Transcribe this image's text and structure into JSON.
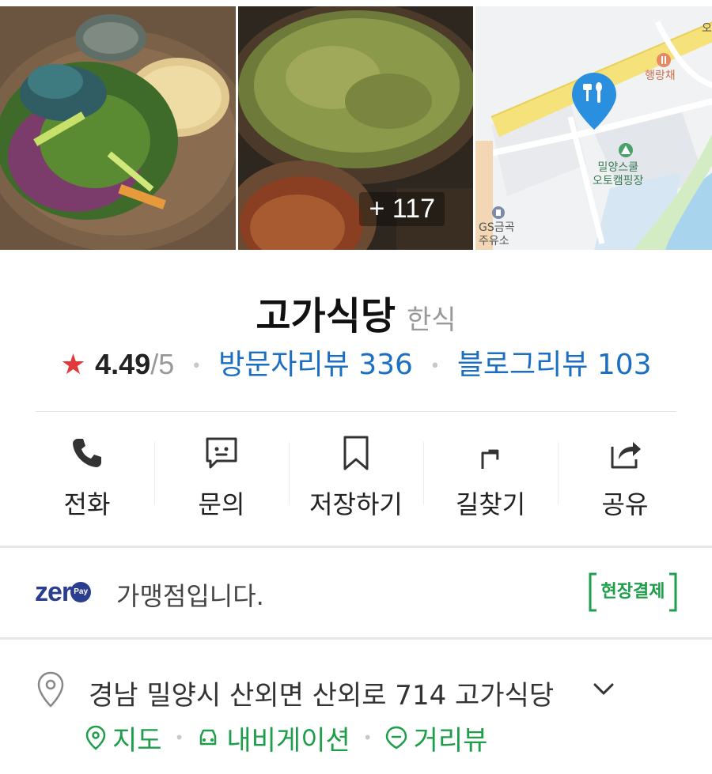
{
  "photos": {
    "more_count": "+ 117",
    "map": {
      "restaurant_label": "행랑채",
      "camping_label": "밀양스쿨\n오토캠핑장",
      "gas_label": "GS금곡\n주유소",
      "edge_label": "오"
    }
  },
  "place": {
    "name": "고가식당",
    "category": "한식"
  },
  "rating": {
    "score": "4.49",
    "max": "/5",
    "visitor_reviews": "방문자리뷰 336",
    "blog_reviews": "블로그리뷰 103"
  },
  "actions": [
    {
      "label": "전화",
      "icon": "phone-icon"
    },
    {
      "label": "문의",
      "icon": "chat-icon"
    },
    {
      "label": "저장하기",
      "icon": "bookmark-icon"
    },
    {
      "label": "길찾기",
      "icon": "directions-icon"
    },
    {
      "label": "공유",
      "icon": "share-icon"
    }
  ],
  "zeropay": {
    "logo_text": "zer",
    "logo_pay": "Pay",
    "description": "가맹점입니다.",
    "badge": "현장결제"
  },
  "address": {
    "text": "경남 밀양시 산외면 산외로 714 고가식당",
    "links": [
      "지도",
      "내비게이션",
      "거리뷰"
    ]
  },
  "colors": {
    "accent_blue": "#1a6fc2",
    "accent_green": "#1e9e4a",
    "star_red": "#e03a3a",
    "map_pin_blue": "#2b8fe0"
  }
}
